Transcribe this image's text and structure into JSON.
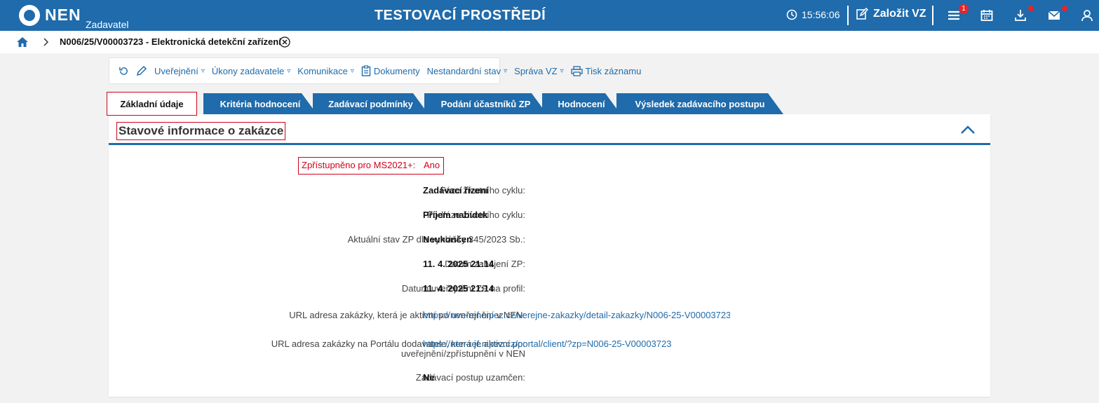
{
  "header": {
    "logo_text": "NEN",
    "logo_sub": "Zadavatel",
    "env_title": "TESTOVACÍ PROSTŘEDÍ",
    "clock": "15:56:06",
    "create_label": "Založit VZ",
    "menu_badge": "1"
  },
  "breadcrumb": {
    "current": "N006/25/V00003723 - Elektronická detekční zařízení"
  },
  "toolbar": {
    "items": [
      {
        "label": "Uveřejnění",
        "caret": "▿"
      },
      {
        "label": "Úkony zadavatele",
        "caret": "▿"
      },
      {
        "label": "Komunikace",
        "caret": "▿"
      },
      {
        "label": "Dokumenty"
      },
      {
        "label": "Nestandardní stav",
        "caret": "▿"
      },
      {
        "label": "Správa VZ",
        "caret": "▿"
      },
      {
        "label": "Tisk záznamu"
      }
    ]
  },
  "tabs": [
    "Základní údaje",
    "Kritéria hodnocení",
    "Zadávací podmínky",
    "Podání účastníků ZP",
    "Hodnocení",
    "Výsledek zadávacího postupu"
  ],
  "section": {
    "title": "Stavové informace o zakázce"
  },
  "fields": {
    "ms_label": "Zpřístupněno pro MS2021+:",
    "ms_value": "Ano",
    "rows": [
      {
        "label": "Fáze životního cyklu:",
        "value": "Zadávací řízení"
      },
      {
        "label": "Podfáze životního cyklu:",
        "value": "Příjem nabídek"
      },
      {
        "label": "Aktuální stav ZP dle vyhlášky 345/2023 Sb.:",
        "value": "Neukončen"
      },
      {
        "label": "Datum zahájení ZP:",
        "value": "11. 4. 2025 21:14"
      },
      {
        "label": "Datum uveřejnění ZP na profil:",
        "value": "11. 4. 2025 21:14"
      },
      {
        "label": "URL adresa zakázky, která je aktivní po uveřejnění v NEN:",
        "value": "https://nen-ref.nipez.cz/verejne-zakazky/detail-zakazky/N006-25-V00003723"
      },
      {
        "label_line1": "URL adresa zakázky na Portálu dodavatele, která je aktivní po:",
        "label_line2": "uveřejnění/zpřístupnění v NEN",
        "value": "https://nen-ref.nipez.cz/portal/client/?zp=N006-25-V00003723"
      },
      {
        "label": "Zadávací postup uzamčen:",
        "value": "Ne"
      }
    ]
  },
  "colors": {
    "primary": "#1f6bab",
    "highlight": "#d0021b"
  }
}
